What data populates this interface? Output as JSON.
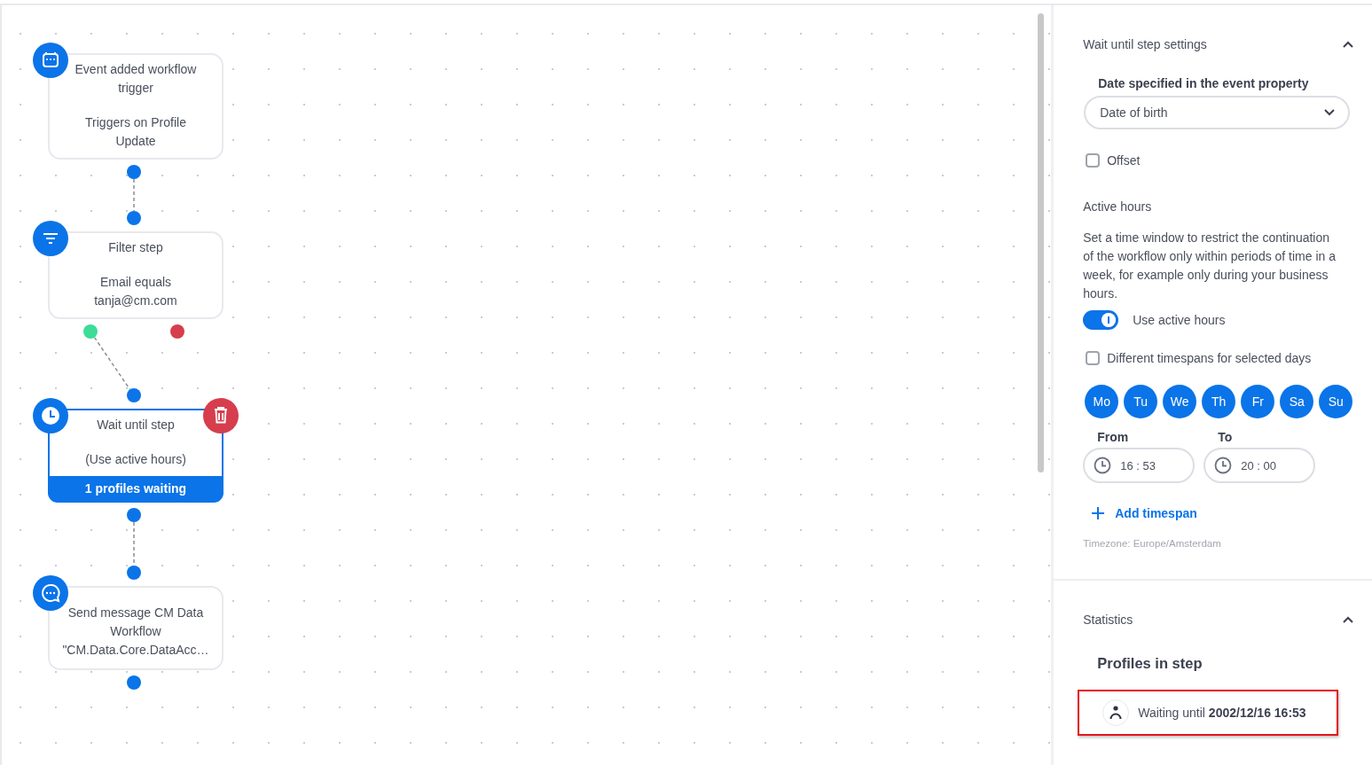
{
  "canvas": {
    "nodes": [
      {
        "kind": "trigger",
        "title": "Event added workflow trigger",
        "detail": "Triggers on Profile Update",
        "selected": false
      },
      {
        "kind": "filter",
        "title": "Filter step",
        "detail": "Email equals tanja@cm.com",
        "selected": false
      },
      {
        "kind": "wait",
        "title": "Wait until step",
        "detail": "(Use active hours)",
        "footer": "1 profiles waiting",
        "selected": true
      },
      {
        "kind": "message",
        "title": "Send message CM Data Workflow \"CM.Data.Core.DataAcc…",
        "selected": false
      }
    ]
  },
  "settings": {
    "title": "Wait until step settings",
    "expanded": true,
    "date_label": "Date specified in the event property",
    "date_value": "Date of birth",
    "offset": {
      "label": "Offset",
      "checked": false
    },
    "active_hours_title": "Active hours",
    "active_hours_text": "Set a time window to restrict the continuation of the workflow only within periods of time in a week, for example only during your business hours.",
    "use_active_hours": {
      "label": "Use active hours",
      "on": true
    },
    "different_timespans": {
      "label": "Different timespans for selected days",
      "checked": false
    },
    "days": [
      {
        "label": "Mo",
        "selected": true
      },
      {
        "label": "Tu",
        "selected": true
      },
      {
        "label": "We",
        "selected": true
      },
      {
        "label": "Th",
        "selected": true
      },
      {
        "label": "Fr",
        "selected": true
      },
      {
        "label": "Sa",
        "selected": true
      },
      {
        "label": "Su",
        "selected": true
      }
    ],
    "from": {
      "label": "From",
      "value": "16 : 53"
    },
    "to": {
      "label": "To",
      "value": "20 : 00"
    },
    "add_timespan": "Add timespan",
    "timezone": "Timezone: Europe/Amsterdam"
  },
  "statistics": {
    "title": "Statistics",
    "expanded": true,
    "subtitle": "Profiles in step",
    "profiles": [
      {
        "text": "Waiting until **2002/12/16 16:53**",
        "highlighted": true
      }
    ]
  }
}
